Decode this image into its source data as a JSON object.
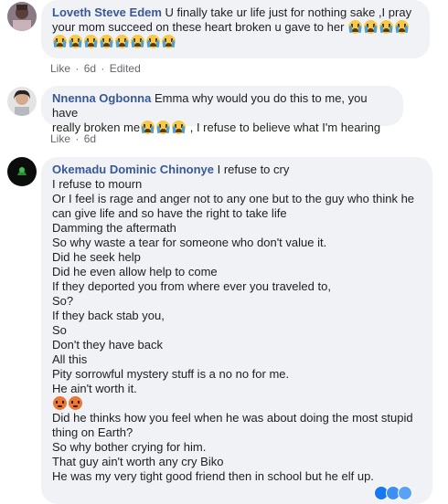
{
  "comments": [
    {
      "author": "Loveth Steve Edem",
      "text_line1": " U finally take ur life just for nothing sake ,I pray",
      "text_line2": "your mom succeed on these heart broken u gave to her ",
      "time": "6d",
      "like": "Like",
      "edited": "Edited"
    },
    {
      "author": "Nnenna Ogbonna",
      "text_line1": " Emma why would you do this to me, you have",
      "text_line2a": "really broken me",
      "text_line2b": " , I refuse to believe what I'm hearing",
      "time": "6d",
      "like": "Like"
    },
    {
      "author": "Okemadu Dominic Chinonye",
      "first": " I refuse to cry",
      "lines": [
        "I refuse to mourn",
        "Or I feel is rage and anger not to any one but to the guy who think he",
        "can give life and so have the right to take life",
        "Damming the aftermath",
        "So why waste a tear for someone who don't value it.",
        "Did he seek help",
        "Did he even allow help to come",
        "If they deported you from where ever you traveled to,",
        "So?",
        "If they back stab you,",
        "So",
        "Don't they have back",
        "All this",
        "Pity sorrowful mystery stuff is a no no for me.",
        "He ain't worth it."
      ],
      "lines2": [
        "Did he thinks how you feel when he was about doing the most stupid",
        "thing on Earth?",
        "So why bother crying for him.",
        "That guy ain't worth any cry Biko",
        "He was my very tight good friend then in school but he elf up."
      ]
    }
  ],
  "icons": {
    "cry": "crying-face-emoji",
    "angry": "angry-face-emoji"
  },
  "colors": {
    "author": "#385898",
    "bubble": "#f0f2f5",
    "meta": "#65676b"
  }
}
